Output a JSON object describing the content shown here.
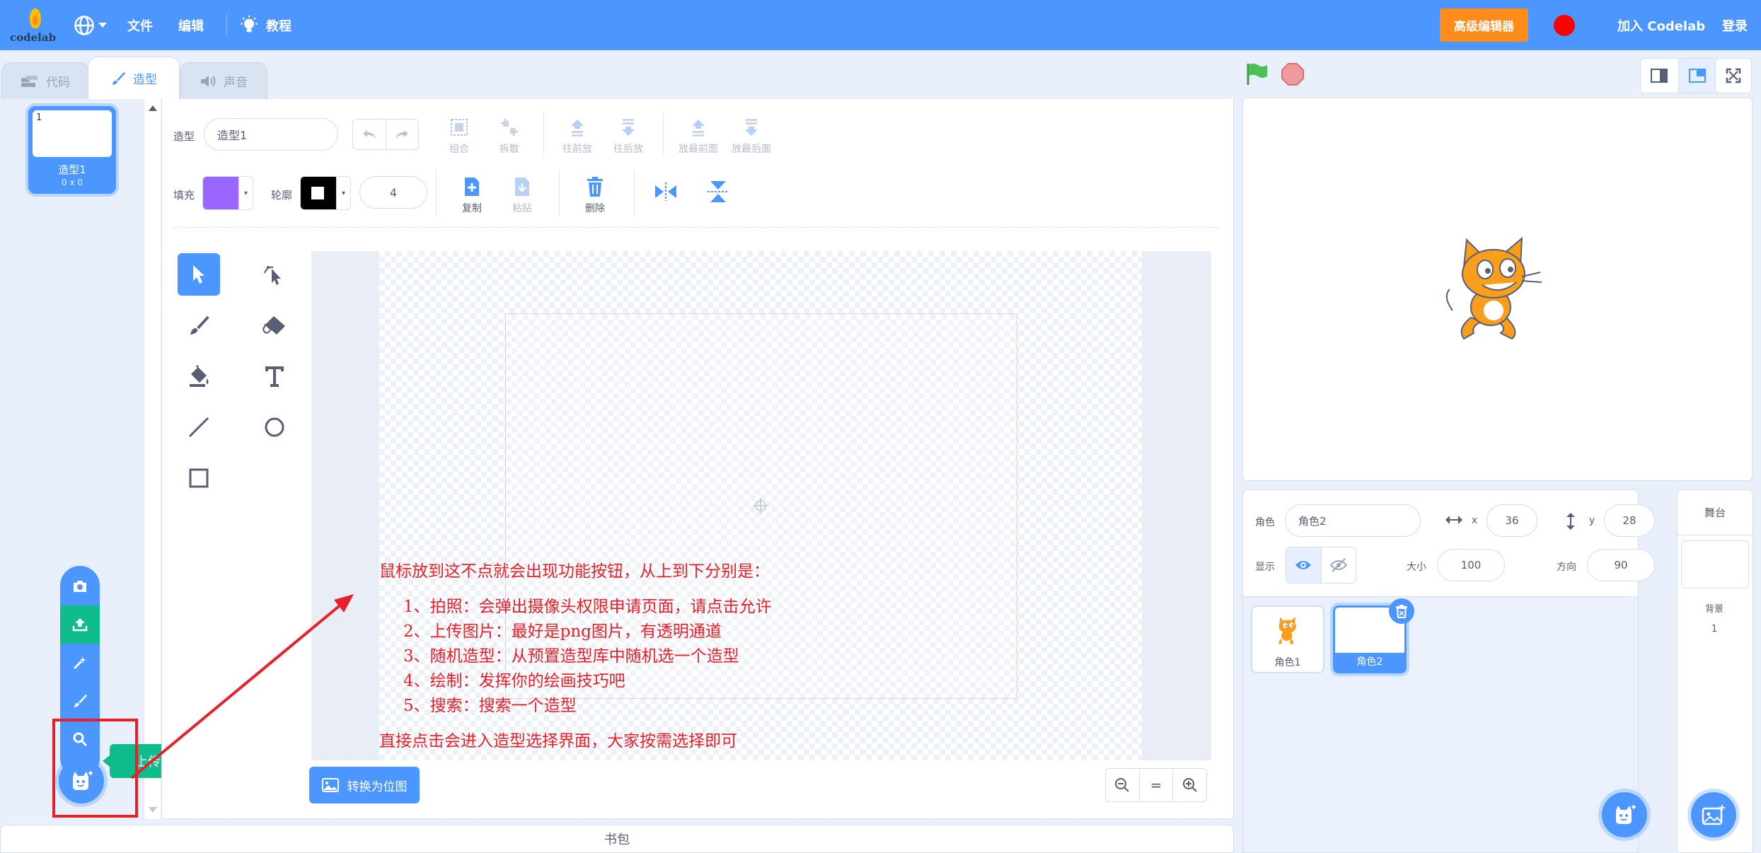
{
  "menubar": {
    "logo_text": "codelab",
    "file": "文件",
    "edit": "编辑",
    "tutorial": "教程",
    "advanced_editor": "高级编辑器",
    "join": "加入 Codelab",
    "login": "登录"
  },
  "tabs": [
    {
      "label": "代码",
      "icon": "code-icon"
    },
    {
      "label": "造型",
      "icon": "brush-icon"
    },
    {
      "label": "声音",
      "icon": "speaker-icon"
    }
  ],
  "costume_list": [
    {
      "index": "1",
      "name": "造型1",
      "size": "0 x 0"
    }
  ],
  "costume_menu": {
    "items": [
      "camera-icon",
      "upload-icon",
      "surprise-icon",
      "paint-icon",
      "search-icon"
    ],
    "tooltip": "上传造型"
  },
  "editor": {
    "costume_label": "造型",
    "costume_name": "造型1",
    "fill_label": "填充",
    "outline_label": "轮廓",
    "fill_color": "#9966ff",
    "outline_color": "#000000",
    "outline_width": "4",
    "group": "组合",
    "ungroup": "拆散",
    "forward": "往前放",
    "backward": "往后放",
    "front": "放最前面",
    "back": "放最后面",
    "copy": "复制",
    "paste": "粘贴",
    "delete": "删除",
    "convert_bitmap": "转换为位图",
    "zoom_reset": "="
  },
  "annotation": {
    "heading": "鼠标放到这不点就会出现功能按钮，从上到下分别是：",
    "lines": [
      "1、拍照：会弹出摄像头权限申请页面，请点击允许",
      "2、上传图片：最好是png图片，有透明通道",
      "3、随机造型：从预置造型库中随机选一个造型",
      "4、绘制：发挥你的绘画技巧吧",
      "5、搜索：搜索一个造型"
    ],
    "footer": "直接点击会进入造型选择界面，大家按需选择即可"
  },
  "backpack": "书包",
  "sprite_info": {
    "sprite_label": "角色",
    "sprite_name": "角色2",
    "x_label": "x",
    "x": "36",
    "y_label": "y",
    "y": "28",
    "show_label": "显示",
    "size_label": "大小",
    "size": "100",
    "direction_label": "方向",
    "direction": "90"
  },
  "sprites": [
    {
      "name": "角色1"
    },
    {
      "name": "角色2"
    }
  ],
  "stage_panel": {
    "title": "舞台",
    "backdrop_label": "背景",
    "backdrop_count": "1"
  },
  "colors": {
    "brand": "#4c97ff",
    "orange": "#ff8c1a",
    "green": "#0fbd8c",
    "annotation_red": "#e8202a"
  }
}
